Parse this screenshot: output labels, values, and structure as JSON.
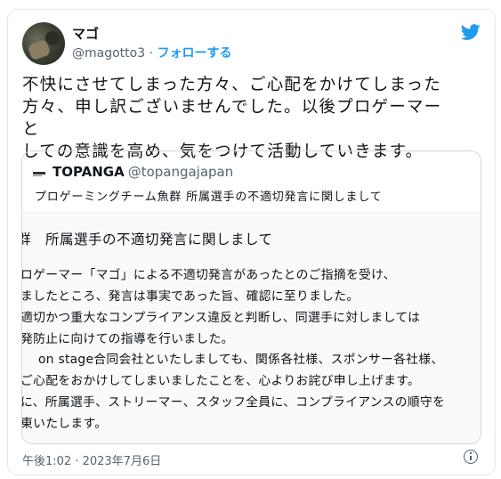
{
  "author": {
    "name": "マゴ",
    "handle": "@magotto3",
    "separator": " · ",
    "follow_label": "フォローする"
  },
  "tweet": {
    "lines": [
      "不快にさせてしまった方々、ご心配をかけてしまった",
      "方々、申し訳ございませんでした。以後プロゲーマーと",
      "しての意識を高め、気をつけて活動していきます。"
    ],
    "timestamp": "午後1:02 · 2023年7月6日"
  },
  "quote": {
    "name": "TOPANGA",
    "handle": "@topangajapan",
    "text": "プロゲーミングチーム魚群 所属選手の不適切発言に関しまして",
    "image": {
      "title": "群　所属選手の不適切発言に関しまして",
      "lines": [
        "ロゲーマー「マゴ」による不適切発言があったとのご指摘を受け、",
        "ましたところ、発言は事実であった旨、確認に至りました。",
        "適切かつ重大なコンプライアンス違反と判断し、同選手に対しましては",
        "発防止に向けての指導を行いました。",
        "on stage合同会社といたしましても、関係各社様、スポンサー各社様、",
        "ご心配をおかけしてしまいましたことを、心よりお詫び申し上げます。",
        "に、所属選手、ストリーマー、スタッフ全員に、コンプライアンスの順守を",
        "東いたします。"
      ]
    }
  },
  "colors": {
    "accent": "#1d9bf0",
    "text": "#0f1419",
    "muted": "#536471",
    "border": "#cfd9de"
  },
  "icons": {
    "brand": "twitter-bird-icon",
    "info": "info-icon"
  }
}
